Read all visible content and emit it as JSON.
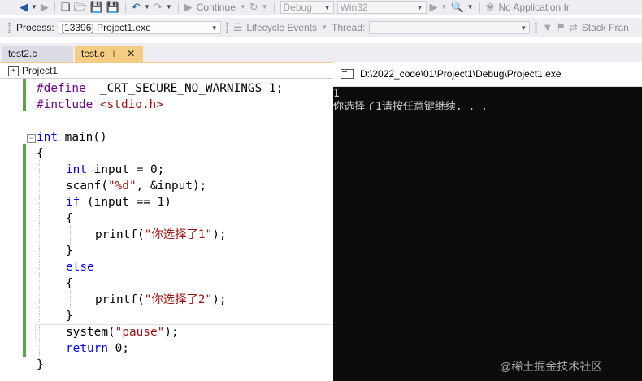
{
  "toolbar": {
    "continue_label": "Continue",
    "config_value": "Debug",
    "platform_value": "Win32",
    "no_app_label": "No Application Ir",
    "process_label": "Process:",
    "process_value": "[13396] Project1.exe",
    "lifecycle_label": "Lifecycle Events",
    "thread_label": "Thread:",
    "stack_label": "Stack Fran"
  },
  "tabs": [
    {
      "label": "test2.c"
    },
    {
      "label": "test.c"
    }
  ],
  "navbar": {
    "project": "Project1"
  },
  "code": {
    "l1": {
      "a": "#define ",
      "b": " _CRT_SECURE_NO_WARNINGS 1;"
    },
    "l2": {
      "a": "#include ",
      "b": "<stdio.h>"
    },
    "l3": {
      "a": "int",
      "b": " main()"
    },
    "l4": "{",
    "l5": {
      "a": "int",
      "b": " input = 0;"
    },
    "l6": {
      "a": "scanf(",
      "b": "\"%d\"",
      "c": ", &input);"
    },
    "l7": {
      "a": "if",
      "b": " (input == 1)"
    },
    "l8": "{",
    "l9": {
      "a": "printf(",
      "b": "\"你选择了1\"",
      "c": ");"
    },
    "l10": "}",
    "l11": "else",
    "l12": "{",
    "l13": {
      "a": "printf(",
      "b": "\"你选择了2\"",
      "c": ");"
    },
    "l14": "}",
    "l15": {
      "a": "system(",
      "b": "\"pause\"",
      "c": ");"
    },
    "l16": {
      "a": "return",
      "b": " 0;"
    },
    "l17": "}"
  },
  "console": {
    "title": "D:\\2022_code\\01\\Project1\\Debug\\Project1.exe",
    "line1": "1",
    "line2": "你选择了1请按任意键继续. . ."
  },
  "watermark": "@稀土掘金技术社区"
}
